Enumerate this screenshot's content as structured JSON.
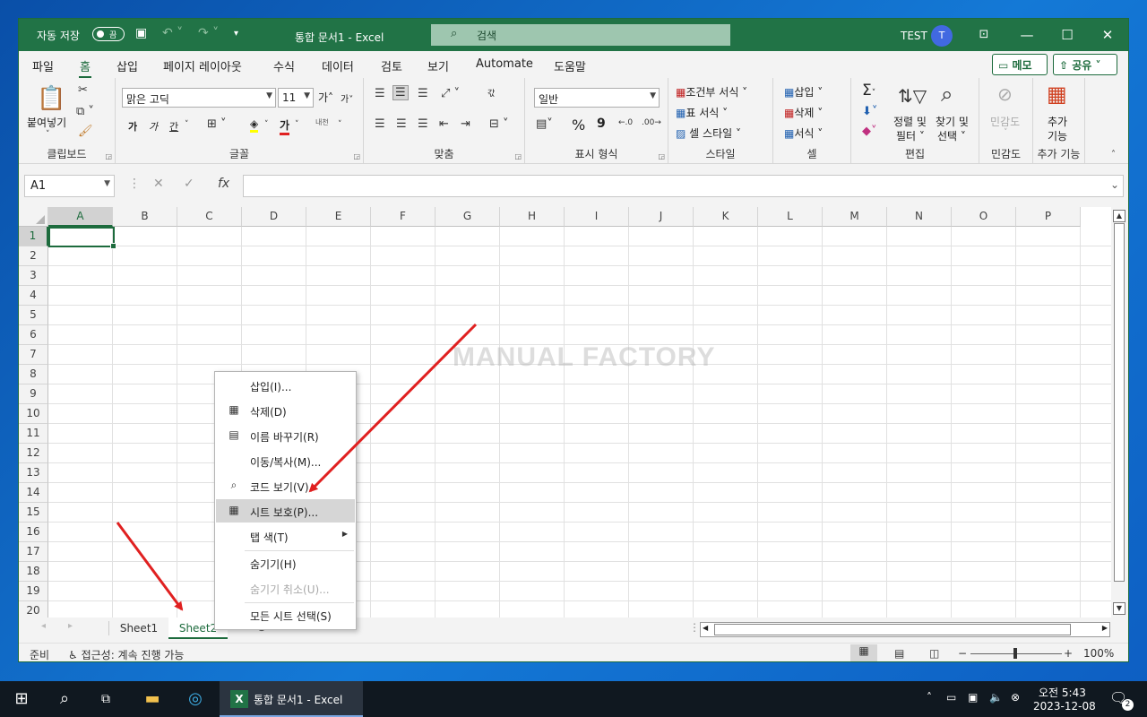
{
  "titlebar": {
    "autosave_label": "자동 저장",
    "autosave_state": "끔",
    "title": "통합 문서1  -  Excel",
    "search_placeholder": "검색",
    "user_name": "TEST",
    "avatar_initial": "T"
  },
  "menu": {
    "items": [
      "파일",
      "홈",
      "삽입",
      "페이지 레이아웃",
      "수식",
      "데이터",
      "검토",
      "보기",
      "Automate",
      "도움말"
    ],
    "active": "홈",
    "memo": "메모",
    "share": "공유"
  },
  "ribbon": {
    "clipboard": {
      "paste": "붙여넣기",
      "label": "클립보드"
    },
    "font": {
      "name": "맑은 고딕",
      "size": "11",
      "grow": "가",
      "shrink": "가",
      "bold": "가",
      "italic": "가",
      "underline": "간",
      "fill": "가",
      "color": "가",
      "phonetic": "내천",
      "label": "글꼴"
    },
    "alignment": {
      "wrap": "갃",
      "label": "맞춤"
    },
    "number": {
      "format": "일반",
      "percent": "%",
      "comma": "9",
      "label": "표시 형식"
    },
    "styles": {
      "conditional": "조건부 서식",
      "table": "표 서식",
      "cell": "셀 스타일",
      "label": "스타일"
    },
    "cells": {
      "insert": "삽입",
      "delete": "삭제",
      "format": "서식",
      "label": "셀"
    },
    "editing": {
      "sum": "Σ",
      "sort_line1": "정렬 및",
      "sort_line2": "필터",
      "find_line1": "찾기 및",
      "find_line2": "선택",
      "label": "편집"
    },
    "sensitivity": {
      "btn": "민감도",
      "label": "민감도"
    },
    "addins": {
      "btn_line1": "추가",
      "btn_line2": "기능",
      "label": "추가 기능"
    }
  },
  "formula": {
    "namebox": "A1",
    "fx": "fx",
    "value": ""
  },
  "grid": {
    "columns": [
      "A",
      "B",
      "C",
      "D",
      "E",
      "F",
      "G",
      "H",
      "I",
      "J",
      "K",
      "L",
      "M",
      "N",
      "O",
      "P"
    ],
    "rows": [
      "1",
      "2",
      "3",
      "4",
      "5",
      "6",
      "7",
      "8",
      "9",
      "10",
      "11",
      "12",
      "13",
      "14",
      "15",
      "16",
      "17",
      "18",
      "19",
      "20"
    ],
    "selected_cell": "A1"
  },
  "sheets": {
    "tabs": [
      "Sheet1",
      "Sheet2"
    ],
    "active": "Sheet2"
  },
  "context_menu": {
    "items": [
      {
        "label": "삽입(I)...",
        "icon": "none",
        "disabled": false
      },
      {
        "label": "삭제(D)",
        "icon": "delete-sheet-icon",
        "disabled": false
      },
      {
        "label": "이름 바꾸기(R)",
        "icon": "rename-sheet-icon",
        "disabled": false
      },
      {
        "label": "이동/복사(M)...",
        "icon": "none",
        "disabled": false
      },
      {
        "label": "코드 보기(V)",
        "icon": "view-code-icon",
        "disabled": false
      },
      {
        "label": "시트 보호(P)...",
        "icon": "protect-sheet-icon",
        "disabled": false,
        "highlighted": true
      },
      {
        "label": "탭 색(T)",
        "icon": "none",
        "disabled": false,
        "submenu": true
      },
      {
        "label": "숨기기(H)",
        "icon": "none",
        "disabled": false
      },
      {
        "label": "숨기기 취소(U)...",
        "icon": "none",
        "disabled": true
      },
      {
        "label": "모든 시트 선택(S)",
        "icon": "none",
        "disabled": false
      }
    ]
  },
  "statusbar": {
    "ready": "준비",
    "accessibility": "접근성: 계속 진행 가능",
    "zoom": "100%",
    "zoom_minus": "−",
    "zoom_plus": "+"
  },
  "watermark": "MANUAL FACTORY",
  "taskbar": {
    "app_label": "통합 문서1 - Excel",
    "time": "오전 5:43",
    "date": "2023-12-08",
    "notifications": "2"
  },
  "colors": {
    "excel_green": "#217346",
    "arrow_red": "#e02020",
    "desktop_blue": "#1479d6"
  }
}
